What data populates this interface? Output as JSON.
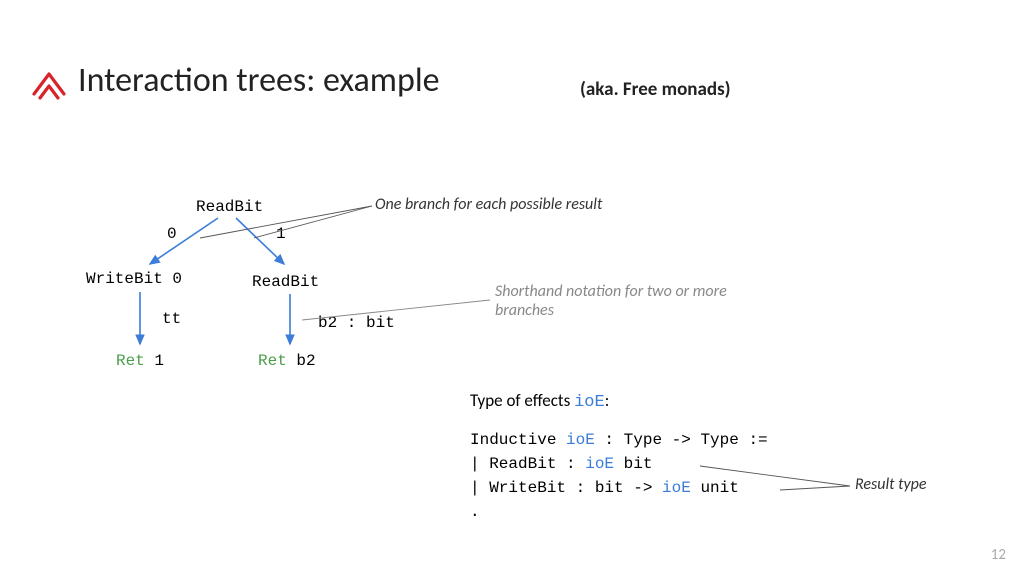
{
  "title": "Interaction trees: example",
  "subtitle": "(aka. Free monads)",
  "tree": {
    "root": "ReadBit",
    "edge_left": "0",
    "edge_right": "1",
    "left_child": "WriteBit 0",
    "right_child": "ReadBit",
    "left_mid": "tt",
    "right_mid": "b2 : bit",
    "left_leaf_ret": "Ret",
    "left_leaf_val": " 1",
    "right_leaf_ret": "Ret",
    "right_leaf_val": " b2"
  },
  "annotation1": "One branch for each possible result",
  "annotation2_line1": "Shorthand notation for two or more",
  "annotation2_line2": "branches",
  "code": {
    "intro_pre": "Type of effects ",
    "intro_ioE": "ioE",
    "intro_post": ":",
    "l1_pre": "Inductive ",
    "l1_ioE": "ioE",
    "l1_post": " : Type -> Type :=",
    "l2_pre": "| ReadBit  : ",
    "l2_ioE": "ioE",
    "l2_post": " bit",
    "l3_pre": "| WriteBit : bit -> ",
    "l3_ioE": "ioE",
    "l3_post": " unit",
    "l4": "."
  },
  "result_type": "Result type",
  "pagenum": "12"
}
